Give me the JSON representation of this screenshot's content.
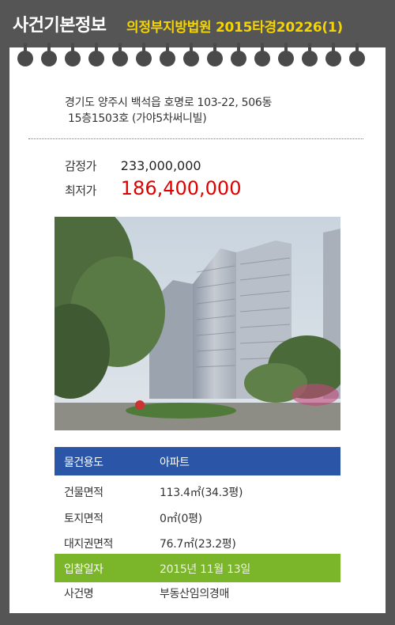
{
  "header": {
    "title": "사건기본정보",
    "case_ref": "의정부지방법원 2015타경20226(1)"
  },
  "colors": {
    "background": "#555555",
    "case_ref": "#f5d400",
    "min_price": "#e00000",
    "usage_row": "#2b56a8",
    "bid_date_row": "#7bb52a"
  },
  "address": {
    "line1": "경기도 양주시 백석읍 호명로 103-22, 506동",
    "line2": "15층1503호 (가야5차써니빌)"
  },
  "prices": {
    "appraisal_label": "감정가",
    "appraisal_value": "233,000,000",
    "minimum_label": "최저가",
    "minimum_value": "186,400,000"
  },
  "details": {
    "usage_label": "물건용도",
    "usage_value": "아파트",
    "building_area_label": "건물면적",
    "building_area_value": "113.4㎡(34.3평)",
    "land_area_label": "토지면적",
    "land_area_value": "0㎡(0평)",
    "site_right_label": "대지권면적",
    "site_right_value": "76.7㎡(23.2평)",
    "bid_date_label": "입찰일자",
    "bid_date_value": "2015년 11월 13일",
    "case_name_label": "사건명",
    "case_name_value": "부동산임의경매"
  }
}
